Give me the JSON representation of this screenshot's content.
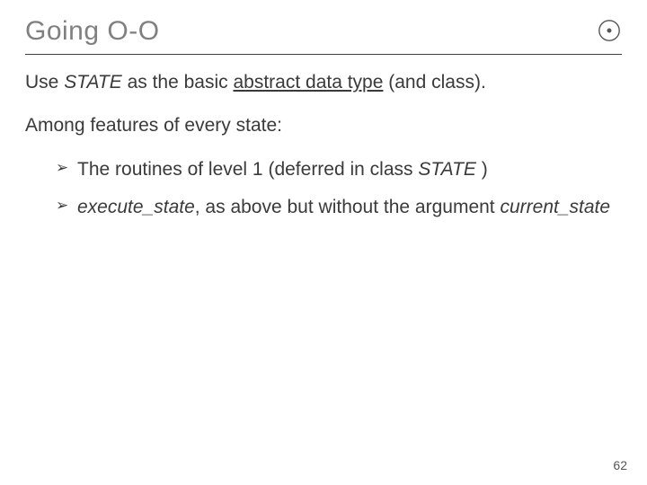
{
  "title": "Going O-O",
  "para1_pre": "Use ",
  "para1_state": "STATE",
  "para1_mid": " as the basic ",
  "para1_adt": "abstract data type",
  "para1_post": " (and class).",
  "para2": "Among features of every state:",
  "b1_pre": "The routines of level 1 (deferred in class ",
  "b1_state": "STATE ",
  "b1_post": ")",
  "b2_exec": "execute_state",
  "b2_mid": ", as above but without the argument ",
  "b2_curr": "current_state",
  "page_number": "62"
}
